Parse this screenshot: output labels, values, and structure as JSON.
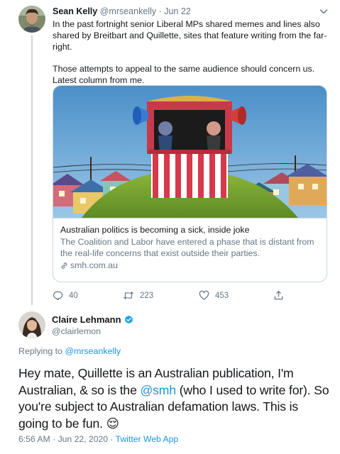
{
  "parent_tweet": {
    "name": "Sean Kelly",
    "handle": "@mrseankelly",
    "separator": "·",
    "date": "Jun 22",
    "paragraph1": "In the past fortnight senior Liberal MPs shared memes and lines also shared by Breitbart and Quillette, sites that feature writing from the far-right.",
    "paragraph2": "Those attempts to appeal to the same audience should concern us. Latest column from me.",
    "card": {
      "title": "Australian politics is becoming a sick, inside joke",
      "description": "The Coalition and Labor have entered a phase that is distant from the real-life concerns that exist outside their parties.",
      "domain": "smh.com.au"
    },
    "actions": {
      "reply_count": "40",
      "retweet_count": "223",
      "like_count": "453"
    }
  },
  "reply_tweet": {
    "name": "Claire Lehmann",
    "handle": "@clairlemon",
    "replying_prefix": "Replying to ",
    "replying_to": "@mrseankelly",
    "text_part1": "Hey mate, Quillette is an Australian publication, I'm Australian, & so is the ",
    "text_mention": "@smh",
    "text_part2": " (who I used to write for). So you're subject to Australian defamation laws. This is going to be fun. ",
    "emoji": "😌",
    "time": "6:56 AM",
    "separator1": " · ",
    "date": "Jun 22, 2020",
    "separator2": " · ",
    "source": "Twitter Web App"
  },
  "colors": {
    "text": "#14171a",
    "muted": "#657786",
    "link": "#1b95e0",
    "border": "#ccd6dd"
  }
}
